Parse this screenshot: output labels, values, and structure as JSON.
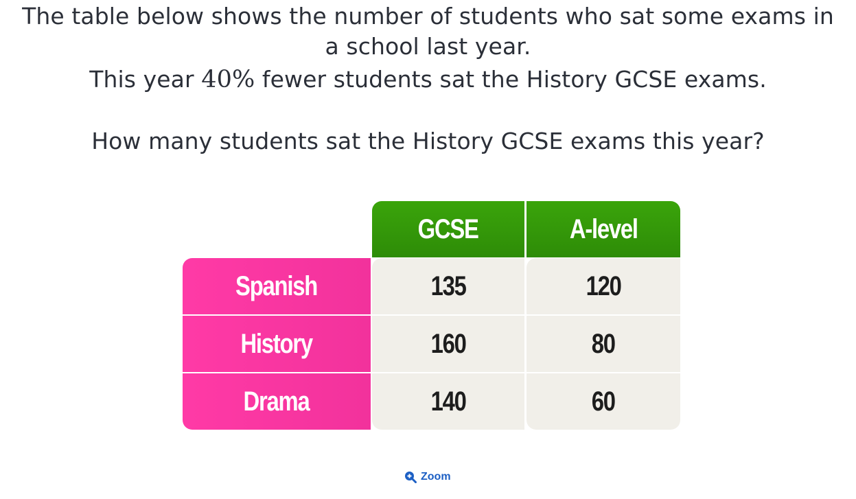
{
  "question": {
    "line1": "The table below shows the number of students who sat some exams in",
    "line2": "a school last year.",
    "line3_prefix": "This year ",
    "line3_math": "40%",
    "line3_suffix": " fewer students sat the History GCSE exams.",
    "ask": "How many students sat the History GCSE exams this year?"
  },
  "table": {
    "headers": [
      "GCSE",
      "A-level"
    ],
    "rows": [
      {
        "label": "Spanish",
        "values": [
          "135",
          "120"
        ]
      },
      {
        "label": "History",
        "values": [
          "160",
          "80"
        ]
      },
      {
        "label": "Drama",
        "values": [
          "140",
          "60"
        ]
      }
    ],
    "colors": {
      "header": "#3aa40a",
      "row_label": "#ff3aa6",
      "cell": "#f1efe9"
    }
  },
  "zoom": {
    "label": "Zoom",
    "icon": "zoom-in-icon",
    "color": "#1c5fc4"
  }
}
